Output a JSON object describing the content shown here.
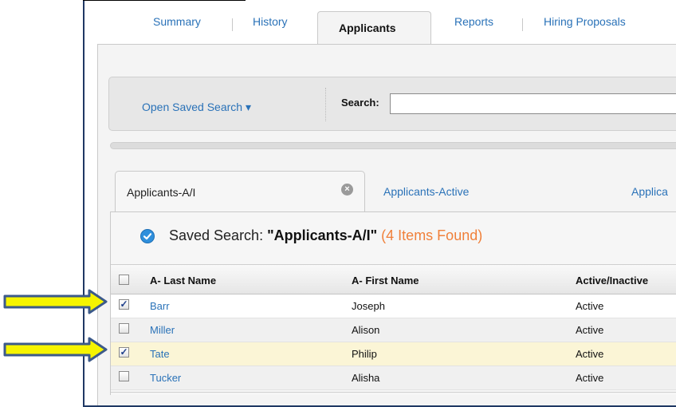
{
  "tabs": [
    {
      "label": "Summary",
      "active": false
    },
    {
      "label": "History",
      "active": false
    },
    {
      "label": "Applicants",
      "active": true
    },
    {
      "label": "Reports",
      "active": false
    },
    {
      "label": "Hiring Proposals",
      "active": false
    }
  ],
  "search": {
    "open_saved_search": "Open Saved Search ▾",
    "label": "Search:",
    "value": ""
  },
  "search_tabs": [
    {
      "label": "Applicants-A/I",
      "active": true,
      "close_icon": "×"
    },
    {
      "label": "Applicants-Active",
      "active": false
    },
    {
      "label": "Applica",
      "active": false
    }
  ],
  "saved_search": {
    "prefix": "Saved Search: ",
    "name": "\"Applicants-A/I\"",
    "count": "(4 Items Found)"
  },
  "table": {
    "columns": [
      "A- Last Name",
      "A- First Name",
      "Active/Inactive"
    ],
    "rows": [
      {
        "last": "Barr",
        "first": "Joseph",
        "status": "Active",
        "checked": true,
        "highlight": false
      },
      {
        "last": "Miller",
        "first": "Alison",
        "status": "Active",
        "checked": false,
        "highlight": false
      },
      {
        "last": "Tate",
        "first": "Philip",
        "status": "Active",
        "checked": true,
        "highlight": true
      },
      {
        "last": "Tucker",
        "first": "Alisha",
        "status": "Active",
        "checked": false,
        "highlight": false
      }
    ]
  },
  "colors": {
    "link": "#2a72b8",
    "count": "#f0803a",
    "highlight_row": "#fbf5d6",
    "arrow_fill": "#f6f400",
    "arrow_stroke": "#3c5a8a"
  }
}
